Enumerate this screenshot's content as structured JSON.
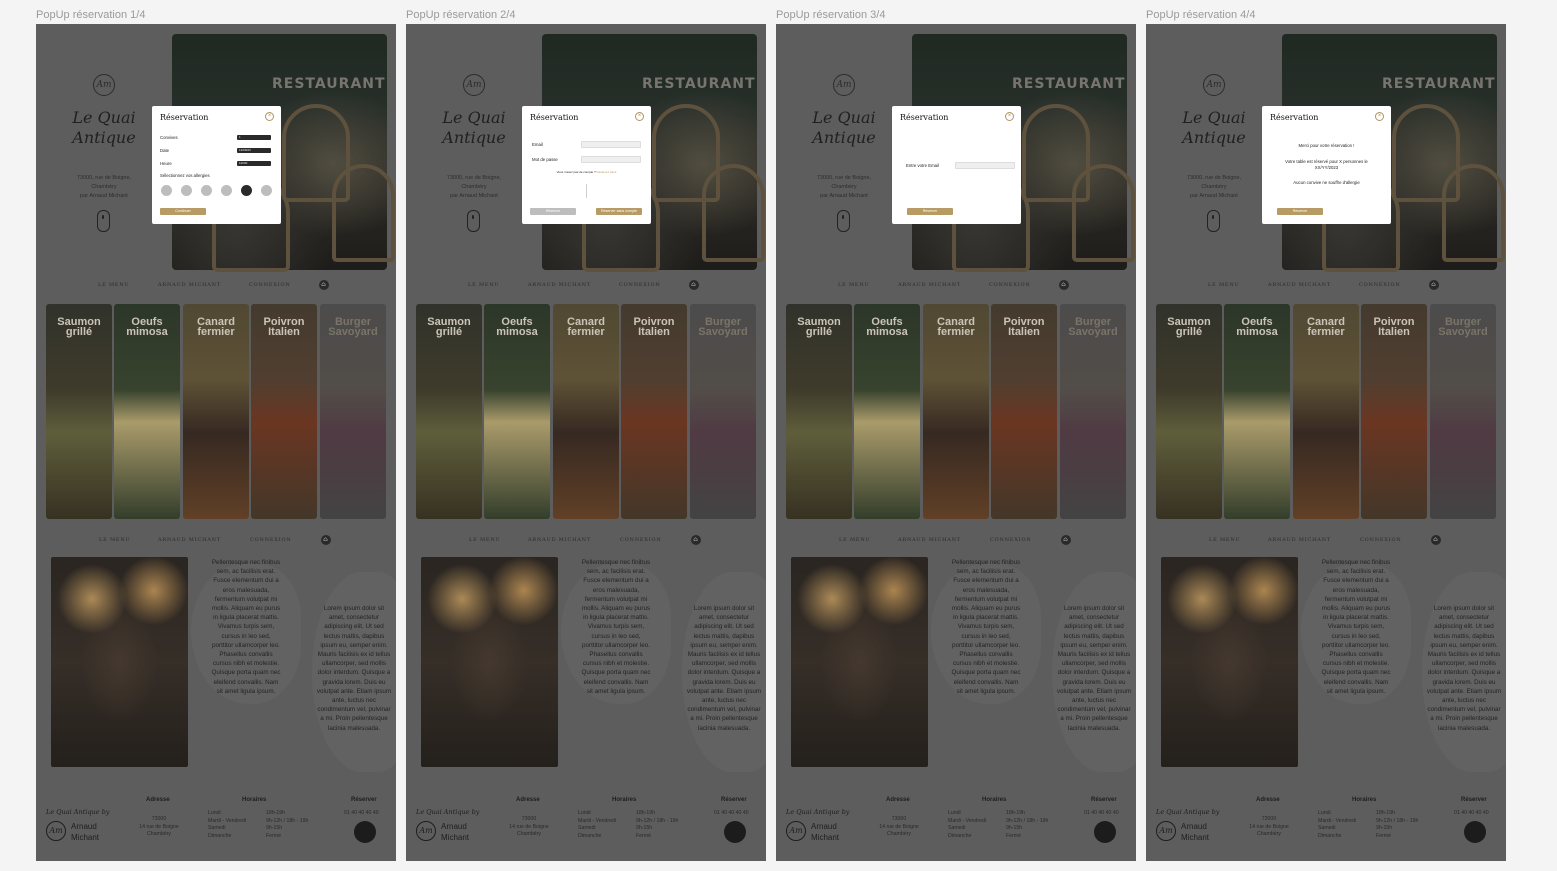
{
  "frames": [
    {
      "title": "PopUp réservation 1/4"
    },
    {
      "title": "PopUp réservation 2/4"
    },
    {
      "title": "PopUp réservation 3/4"
    },
    {
      "title": "PopUp réservation 4/4"
    }
  ],
  "site": {
    "hero_sign": "RESTAURANT",
    "logo_initials": "Am",
    "brand_line1": "Le Quai",
    "brand_line2": "Antique",
    "address_line1": "73000, rue de Boigne,",
    "address_line2": "Chambéry",
    "address_line3": "par Arnaud Michant",
    "nav": [
      "LE MENU",
      "ARNAUD MICHANT",
      "CONNEXION"
    ],
    "dishes": [
      {
        "l1": "Saumon",
        "l2": "grillé"
      },
      {
        "l1": "Oeufs",
        "l2": "mimosa"
      },
      {
        "l1": "Canard",
        "l2": "fermier"
      },
      {
        "l1": "Poivron",
        "l2": "Italien"
      },
      {
        "l1": "Burger",
        "l2": "Savoyard"
      }
    ],
    "para1": "Pellentesque nec finibus sem, ac facilisis erat. Fusce elementum dui a eros malesuada, fermentum volutpat mi mollis. Aliquam eu purus in ligula placerat mattis. Vivamus turpis sem, cursus in leo sed, porttitor ullamcorper leo. Phasellus convallis cursus nibh et molestie. Quisque porta quam nec eleifend convallis. Nam sit amet ligula ipsum.",
    "para2": "Lorem ipsum dolor sit amet, consectetur adipiscing elit. Ut sed lectus mattis, dapibus ipsum eu, semper enim. Mauris facilisis ex id tellus ullamcorper, sed mollis dolor interdum. Quisque a gravida lorem. Duis eu volutpat ante. Etiam ipsum ante, luctus nec condimentum vel, pulvinar a mi. Proin pellentesque lacinia malesuada.",
    "footer": {
      "brand_by": "Le Quai Antique by",
      "name1": "Arnaud",
      "name2": "Michant",
      "adresse_h": "Adresse",
      "adresse1": "73000",
      "adresse2": "14 rue de Boigne",
      "adresse3": "Chambéry",
      "horaires_h": "Horaires",
      "days1": "Lundi",
      "days2": "Mardi - Vendredi",
      "days3": "Samedi",
      "days4": "Dimanche",
      "hours1": "18h-19h",
      "hours2": "9h-12h / 18h - 19h",
      "hours3": "9h-15h",
      "hours4": "Fermé",
      "reserver_h": "Réserver",
      "phone": "01 40 40 40 40"
    }
  },
  "modal1": {
    "title": "Réservation",
    "close": "×",
    "couverts_label": "Convives",
    "couverts_value": "1",
    "date_label": "Date",
    "date_value": "12/09/23",
    "heure_label": "Heure",
    "heure_value": "12h00",
    "allergy_label": "Sélectionnez vos allergies",
    "continue_btn": "Continuer"
  },
  "modal2": {
    "title": "Réservation",
    "close": "×",
    "email_label": "Email",
    "password_label": "Mot de passe",
    "no_account_text": "Vous n'avez pas de compte ?",
    "no_account_link": "Réservez sans",
    "reserve_btn": "Réserver",
    "reserve_nocount_btn": "Réserver sans compte"
  },
  "modal3": {
    "title": "Réservation",
    "close": "×",
    "email_label": "Entre votre Email",
    "reserve_btn": "Réserver"
  },
  "modal4": {
    "title": "Réservation",
    "close": "×",
    "line1": "Merci pour votre réservation !",
    "line2": "Votre table est réservé pour X personnes le XX/YY/2023",
    "line3": "Aucun convive ne souffre d'allergie",
    "reserve_btn": "Réserver"
  },
  "colors": {
    "gold": "#b79a64",
    "overlay": "#6a6a6a"
  }
}
